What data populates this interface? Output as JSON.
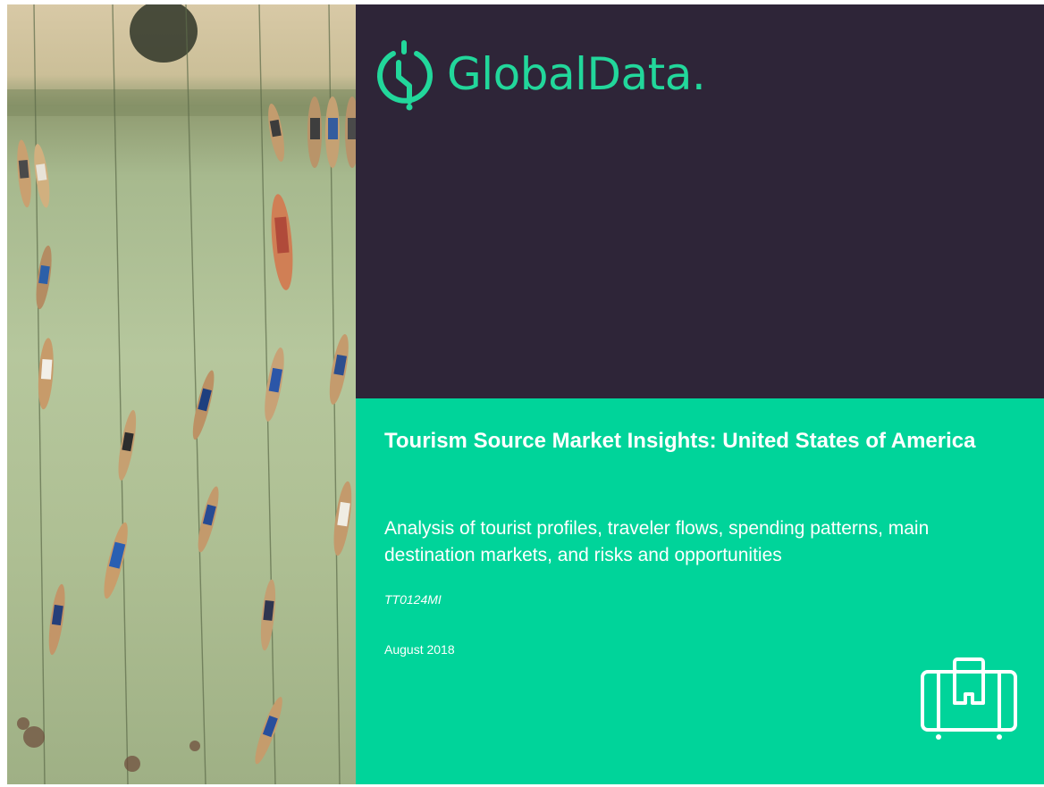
{
  "cover": {
    "brand_name": "GlobalData.",
    "title": "Tourism Source Market Insights: United States of America",
    "subtitle": "Analysis of tourist profiles, traveler flows, spending patterns, main destination markets, and risks and opportunities",
    "report_code": "TT0124MI",
    "date": "August 2018"
  },
  "icons": {
    "logo": "globaldata-logo-icon",
    "travel": "suitcase-icon"
  },
  "colors": {
    "dark_panel": "#2e2538",
    "accent_green": "#00d49a",
    "logo_green": "#22d79b",
    "text_light": "#ffffff"
  }
}
